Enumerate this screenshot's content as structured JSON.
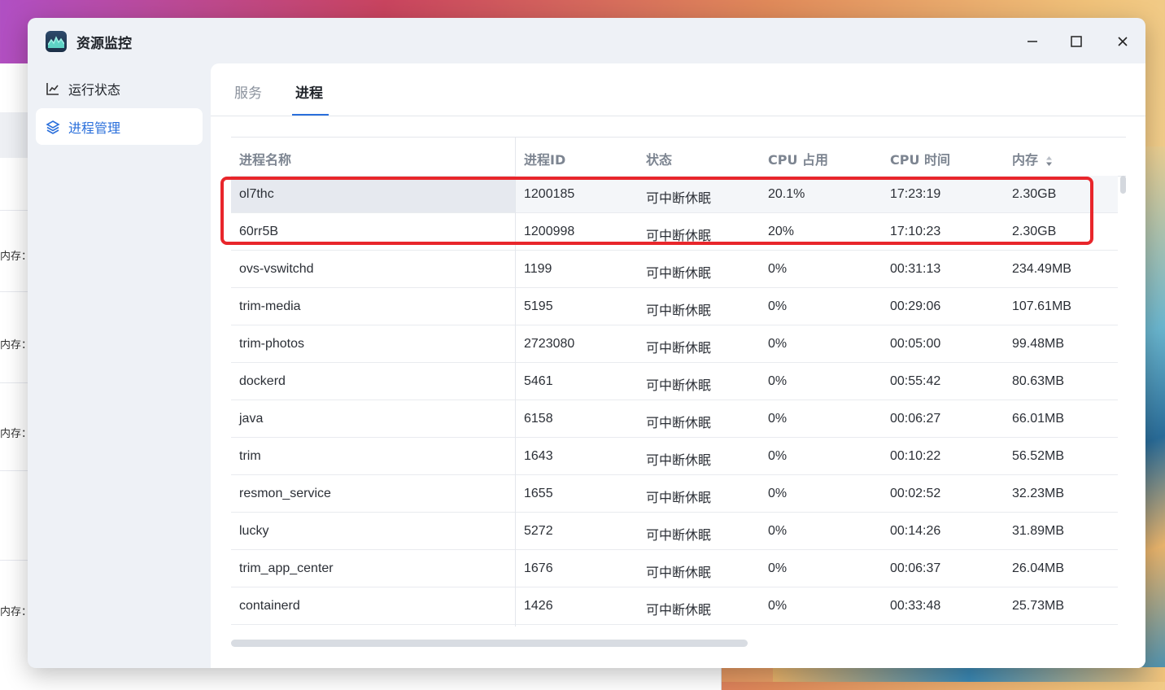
{
  "window": {
    "title": "资源监控"
  },
  "sidebar": {
    "items": [
      {
        "label": "运行状态",
        "icon": "line-chart-icon",
        "active": false
      },
      {
        "label": "进程管理",
        "icon": "layers-icon",
        "active": true
      }
    ]
  },
  "tabs": [
    {
      "label": "服务",
      "active": false
    },
    {
      "label": "进程",
      "active": true
    }
  ],
  "table": {
    "columns": [
      "进程名称",
      "进程ID",
      "状态",
      "CPU 占用",
      "CPU 时间",
      "内存"
    ],
    "rows": [
      {
        "name": "ol7thc",
        "pid": "1200185",
        "state": "可中断休眠",
        "cpu": "20.1%",
        "time": "17:23:19",
        "mem": "2.30GB"
      },
      {
        "name": "60rr5B",
        "pid": "1200998",
        "state": "可中断休眠",
        "cpu": "20%",
        "time": "17:10:23",
        "mem": "2.30GB"
      },
      {
        "name": "ovs-vswitchd",
        "pid": "1199",
        "state": "可中断休眠",
        "cpu": "0%",
        "time": "00:31:13",
        "mem": "234.49MB"
      },
      {
        "name": "trim-media",
        "pid": "5195",
        "state": "可中断休眠",
        "cpu": "0%",
        "time": "00:29:06",
        "mem": "107.61MB"
      },
      {
        "name": "trim-photos",
        "pid": "2723080",
        "state": "可中断休眠",
        "cpu": "0%",
        "time": "00:05:00",
        "mem": "99.48MB"
      },
      {
        "name": "dockerd",
        "pid": "5461",
        "state": "可中断休眠",
        "cpu": "0%",
        "time": "00:55:42",
        "mem": "80.63MB"
      },
      {
        "name": "java",
        "pid": "6158",
        "state": "可中断休眠",
        "cpu": "0%",
        "time": "00:06:27",
        "mem": "66.01MB"
      },
      {
        "name": "trim",
        "pid": "1643",
        "state": "可中断休眠",
        "cpu": "0%",
        "time": "00:10:22",
        "mem": "56.52MB"
      },
      {
        "name": "resmon_service",
        "pid": "1655",
        "state": "可中断休眠",
        "cpu": "0%",
        "time": "00:02:52",
        "mem": "32.23MB"
      },
      {
        "name": "lucky",
        "pid": "5272",
        "state": "可中断休眠",
        "cpu": "0%",
        "time": "00:14:26",
        "mem": "31.89MB"
      },
      {
        "name": "trim_app_center",
        "pid": "1676",
        "state": "可中断休眠",
        "cpu": "0%",
        "time": "00:06:37",
        "mem": "26.04MB"
      },
      {
        "name": "containerd",
        "pid": "1426",
        "state": "可中断休眠",
        "cpu": "0%",
        "time": "00:33:48",
        "mem": "25.73MB"
      }
    ]
  },
  "background_window": {
    "labels": [
      "内存：",
      "内存：",
      "内存：",
      "内存："
    ]
  },
  "colors": {
    "accent": "#2a6fdb",
    "highlight": "#e8262b"
  }
}
